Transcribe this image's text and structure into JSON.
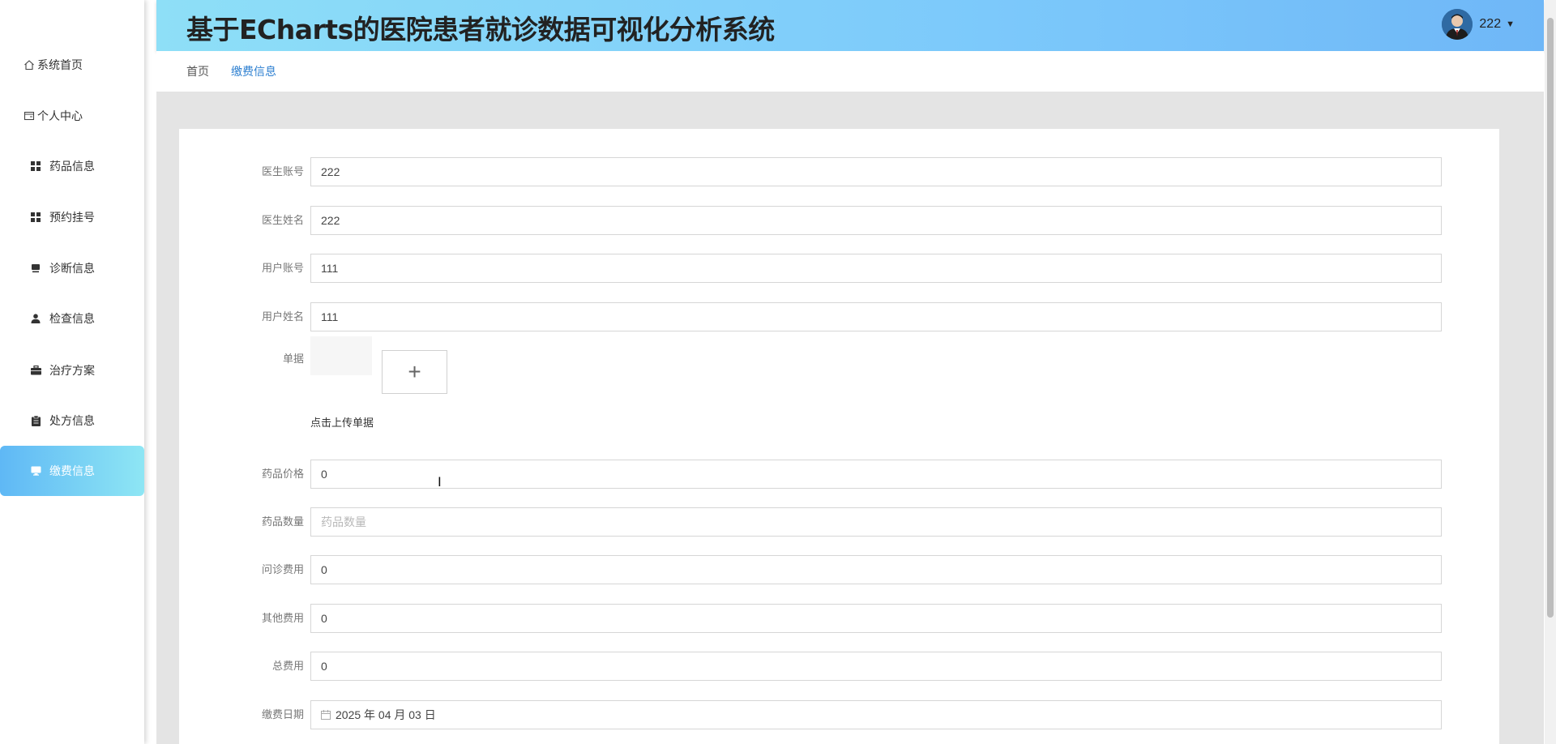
{
  "app": {
    "title": "基于ECharts的医院患者就诊数据可视化分析系统",
    "user": {
      "name": "222"
    }
  },
  "sidebar": {
    "items": [
      {
        "label": "系统首页",
        "icon": "home-icon"
      },
      {
        "label": "个人中心",
        "icon": "user-card-icon"
      },
      {
        "label": "药品信息",
        "icon": "grid-icon"
      },
      {
        "label": "预约挂号",
        "icon": "grid-icon"
      },
      {
        "label": "诊断信息",
        "icon": "cup-icon"
      },
      {
        "label": "检查信息",
        "icon": "person-icon"
      },
      {
        "label": "治疗方案",
        "icon": "briefcase-icon"
      },
      {
        "label": "处方信息",
        "icon": "clipboard-icon"
      },
      {
        "label": "缴费信息",
        "icon": "monitor-icon",
        "active": true
      }
    ]
  },
  "breadcrumb": {
    "home": "首页",
    "current": "缴费信息"
  },
  "form": {
    "doctor_account": {
      "label": "医生账号",
      "value": "222"
    },
    "doctor_name": {
      "label": "医生姓名",
      "value": "222"
    },
    "user_account": {
      "label": "用户账号",
      "value": "111"
    },
    "user_name": {
      "label": "用户姓名",
      "value": "111"
    },
    "receipt": {
      "label": "单据",
      "hint": "点击上传单据",
      "upload_symbol": "+"
    },
    "drug_price": {
      "label": "药品价格",
      "value": "0"
    },
    "drug_quantity": {
      "label": "药品数量",
      "value": "",
      "placeholder": "药品数量"
    },
    "consult_fee": {
      "label": "问诊费用",
      "value": "0"
    },
    "other_fee": {
      "label": "其他费用",
      "value": "0"
    },
    "total_fee": {
      "label": "总费用",
      "value": "0"
    },
    "payment_date": {
      "label": "缴费日期",
      "value": "2025 年 04 月 03 日",
      "icon": "calendar-icon"
    }
  },
  "colors": {
    "header_gradient": [
      "#8edff7",
      "#6fb7f7"
    ],
    "active_menu_gradient": [
      "#5fb8f5",
      "#8ee6f4"
    ],
    "breadcrumb_current": "#2d7fd0",
    "content_bg": "#e4e4e4"
  }
}
